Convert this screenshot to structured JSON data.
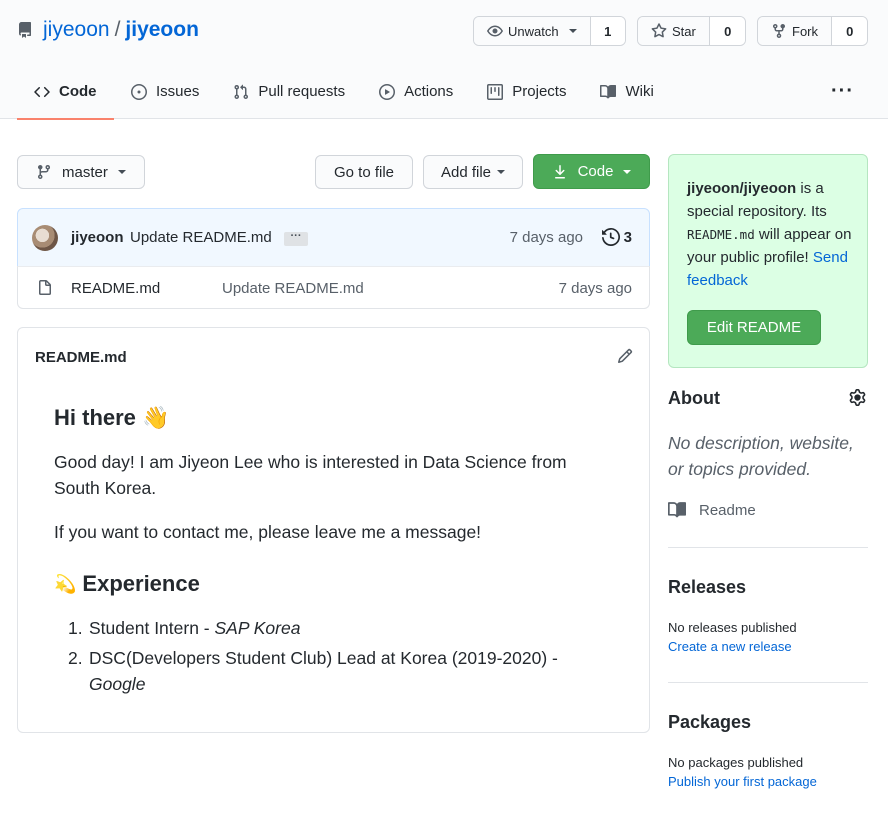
{
  "repo": {
    "owner": "jiyeoon",
    "separator": "/",
    "name": "jiyeoon"
  },
  "actions": {
    "unwatch": {
      "label": "Unwatch",
      "count": "1"
    },
    "star": {
      "label": "Star",
      "count": "0"
    },
    "fork": {
      "label": "Fork",
      "count": "0"
    }
  },
  "tabs": [
    {
      "label": "Code",
      "icon": "code-icon",
      "active": true
    },
    {
      "label": "Issues",
      "icon": "issue-icon"
    },
    {
      "label": "Pull requests",
      "icon": "pull-request-icon"
    },
    {
      "label": "Actions",
      "icon": "play-icon"
    },
    {
      "label": "Projects",
      "icon": "project-icon"
    },
    {
      "label": "Wiki",
      "icon": "book-icon"
    }
  ],
  "more_label": "···",
  "file_nav": {
    "branch": "master",
    "go_to_file": "Go to file",
    "add_file": "Add file",
    "code": "Code"
  },
  "commit": {
    "author": "jiyeoon",
    "message": "Update README.md",
    "ellipsis": "···",
    "time": "7 days ago",
    "history_count": "3"
  },
  "files": [
    {
      "name": "README.md",
      "message": "Update README.md",
      "time": "7 days ago"
    }
  ],
  "readme": {
    "title": "README.md",
    "heading": "Hi there 👋",
    "p1": "Good day! I am Jiyeon Lee who is interested in Data Science from South Korea.",
    "p2": "If you want to contact me, please leave me a message!",
    "experience_emoji": "💫",
    "experience_heading": "Experience",
    "list": [
      {
        "num": "1.",
        "text": "Student Intern - ",
        "em": "SAP Korea"
      },
      {
        "num": "2.",
        "text": "DSC(Developers Student Club) Lead at Korea (2019-2020) - ",
        "em": "Google"
      }
    ]
  },
  "notice": {
    "repo": "jiyeoon/jiyeoon",
    "text1": " is a special repository. Its ",
    "code": "README.md",
    "text2": " will appear on your public profile! ",
    "feedback": "Send feedback",
    "button": "Edit README"
  },
  "about": {
    "heading": "About",
    "description": "No description, website, or topics provided.",
    "readme_link": "Readme"
  },
  "releases": {
    "heading": "Releases",
    "status": "No releases published",
    "link": "Create a new release"
  },
  "packages": {
    "heading": "Packages",
    "status": "No packages published",
    "link": "Publish your first package"
  },
  "colors": {
    "link": "#0366d6",
    "green": "#4caa58",
    "tab_underline": "#f9826c",
    "notice_bg": "#dcffe4"
  }
}
